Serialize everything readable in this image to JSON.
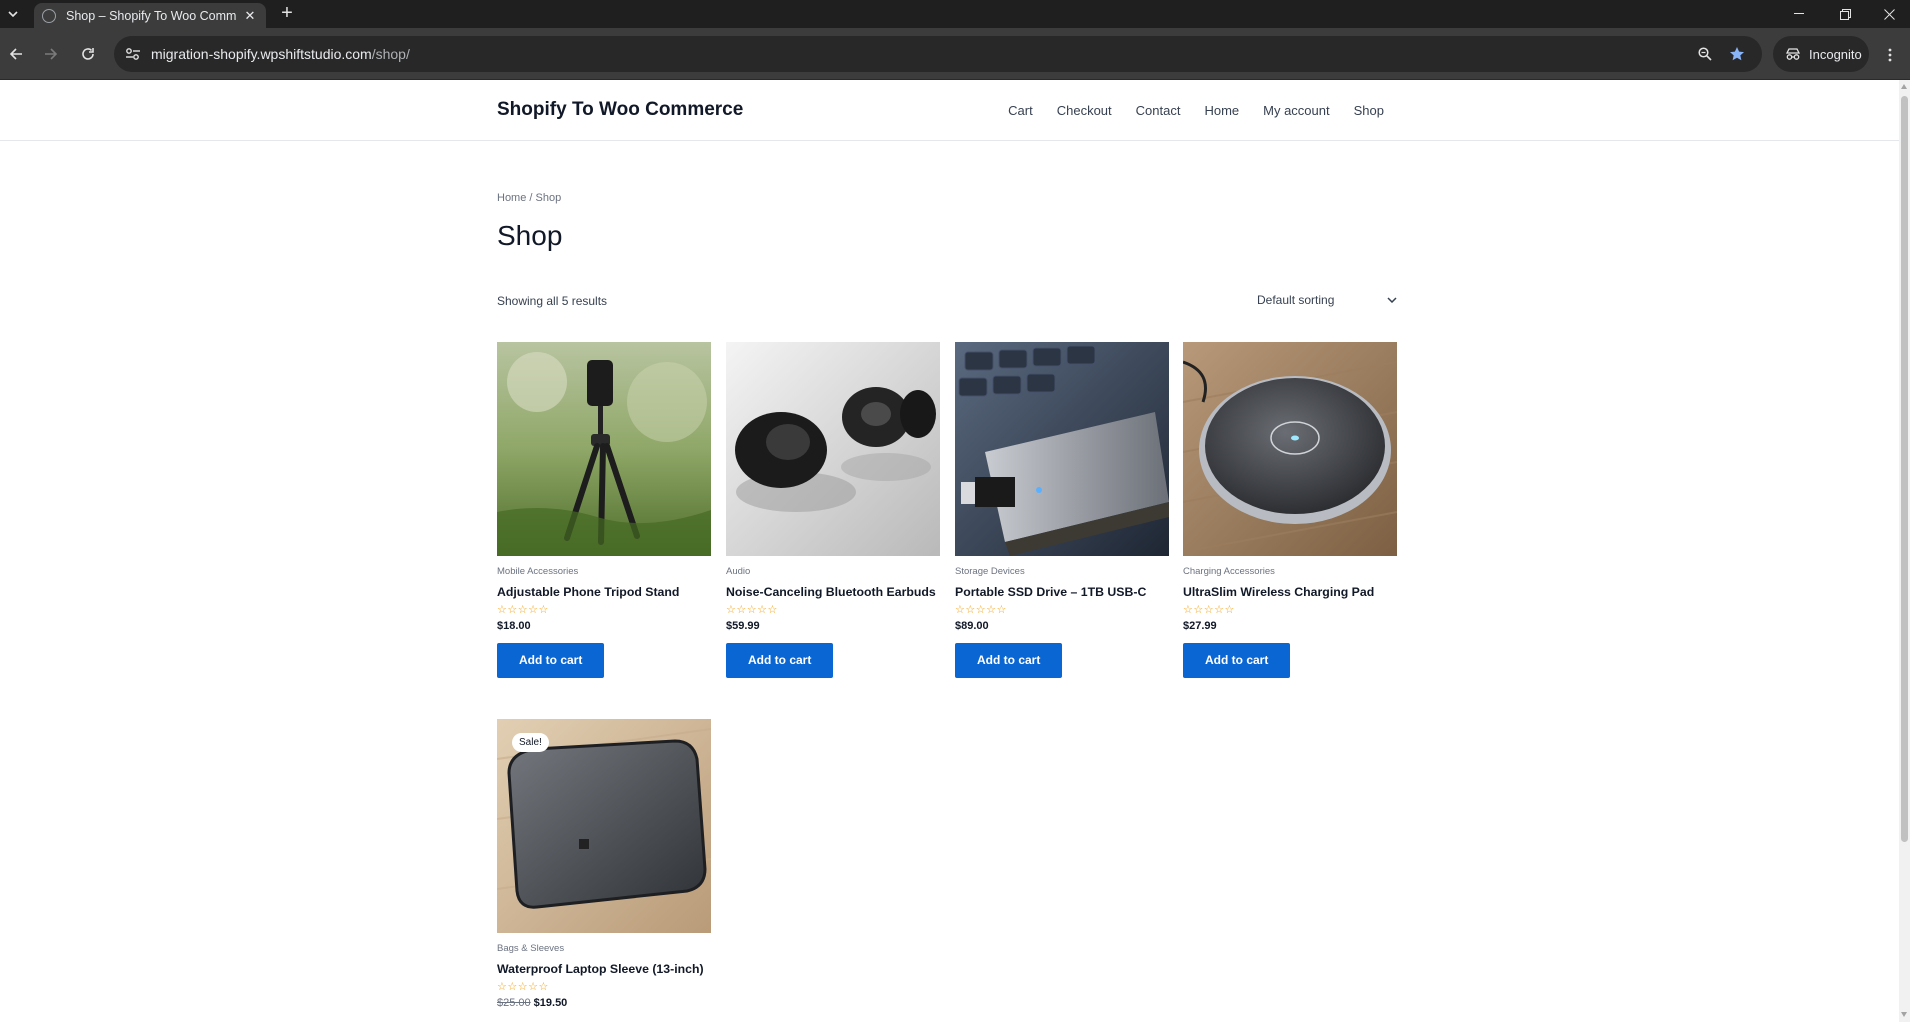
{
  "browser": {
    "tab_title": "Shop – Shopify To Woo Commerce",
    "url_host": "migration-shopify.wpshiftstudio.com",
    "url_path": "/shop/",
    "incognito_label": "Incognito"
  },
  "header": {
    "site_title": "Shopify To Woo Commerce",
    "nav": [
      "Cart",
      "Checkout",
      "Contact",
      "Home",
      "My account",
      "Shop"
    ]
  },
  "main": {
    "breadcrumb": "Home / Shop",
    "title": "Shop",
    "result_count": "Showing all 5 results",
    "sorting": "Default sorting"
  },
  "products": [
    {
      "category": "Mobile Accessories",
      "name": "Adjustable Phone Tripod Stand",
      "rating_stars": "☆☆☆☆☆",
      "price": "$18.00",
      "button": "Add to cart"
    },
    {
      "category": "Audio",
      "name": "Noise-Canceling Bluetooth Earbuds",
      "rating_stars": "☆☆☆☆☆",
      "price": "$59.99",
      "button": "Add to cart"
    },
    {
      "category": "Storage Devices",
      "name": "Portable SSD Drive – 1TB USB-C",
      "rating_stars": "☆☆☆☆☆",
      "price": "$89.00",
      "button": "Add to cart"
    },
    {
      "category": "Charging Accessories",
      "name": "UltraSlim Wireless Charging Pad",
      "rating_stars": "☆☆☆☆☆",
      "price": "$27.99",
      "button": "Add to cart"
    },
    {
      "category": "Bags & Sleeves",
      "name": "Waterproof Laptop Sleeve (13-inch)",
      "rating_stars": "☆☆☆☆☆",
      "old_price": "$25.00",
      "price": "$19.50",
      "sale_badge": "Sale!"
    }
  ],
  "colors": {
    "button": "#0a66d2",
    "stars": "#f59e0b",
    "chrome_dark": "#1f1f1f",
    "chrome_toolbar": "#3c3c3c"
  }
}
